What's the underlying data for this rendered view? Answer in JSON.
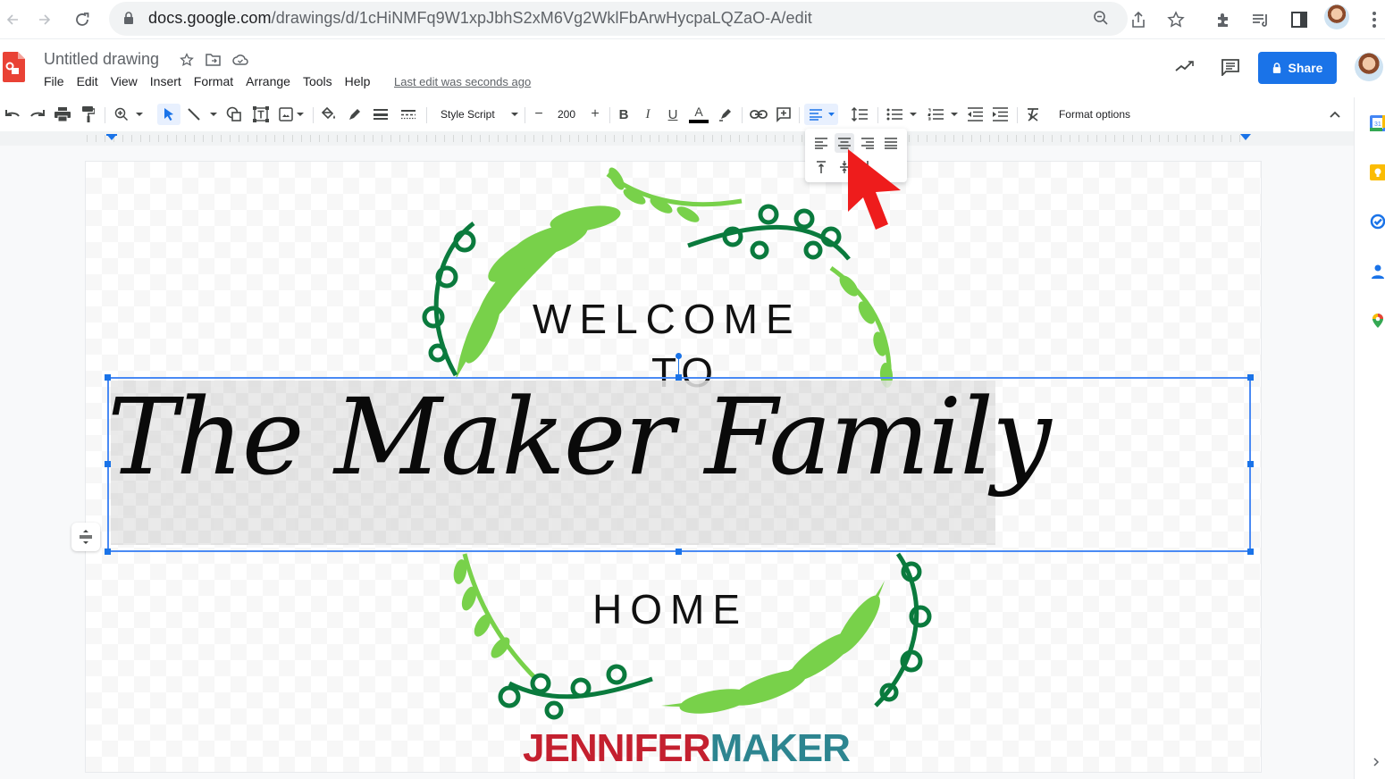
{
  "browser": {
    "url_host": "docs.google.com",
    "url_path": "/drawings/d/1cHiNMFq9W1xpJbhS2xM6Vg2WklFbArwHycpaLQZaO-A/edit",
    "icons": [
      "back-arrow-icon",
      "forward-arrow-icon",
      "reload-icon",
      "lock-icon",
      "zoom-icon",
      "share-page-icon",
      "bookmark-star-icon",
      "extensions-icon",
      "media-queue-icon",
      "side-panel-icon",
      "profile-avatar",
      "more-menu-icon"
    ]
  },
  "app": {
    "title": "Untitled drawing",
    "menu": [
      "File",
      "Edit",
      "View",
      "Insert",
      "Format",
      "Arrange",
      "Tools",
      "Help"
    ],
    "last_edit": "Last edit was seconds ago",
    "share_label": "Share"
  },
  "toolbar": {
    "font_name": "Style Script",
    "font_size": "200",
    "minus": "−",
    "plus": "+",
    "format_options": "Format options",
    "text_color": "#000000"
  },
  "align_menu": {
    "horizontal": [
      "Left",
      "Center",
      "Right",
      "Justify"
    ],
    "vertical": [
      "Top",
      "Middle",
      "Bottom"
    ],
    "active": "Center"
  },
  "canvas": {
    "line1": "WELCOME",
    "line2": "TO",
    "script": "The Maker Family",
    "line3": "HOME",
    "watermark_a": "JENNIFER",
    "watermark_b": "MAKER"
  },
  "colors": {
    "accent": "#1a73e8",
    "leaf_light": "#78d14a",
    "leaf_dark": "#0a7a3d",
    "brand_red": "#c4202f",
    "brand_teal": "#2d8590",
    "cursor_red": "#ee1c1c"
  },
  "side_panel": [
    "calendar-icon",
    "keep-icon",
    "tasks-icon",
    "contacts-icon",
    "maps-icon"
  ]
}
